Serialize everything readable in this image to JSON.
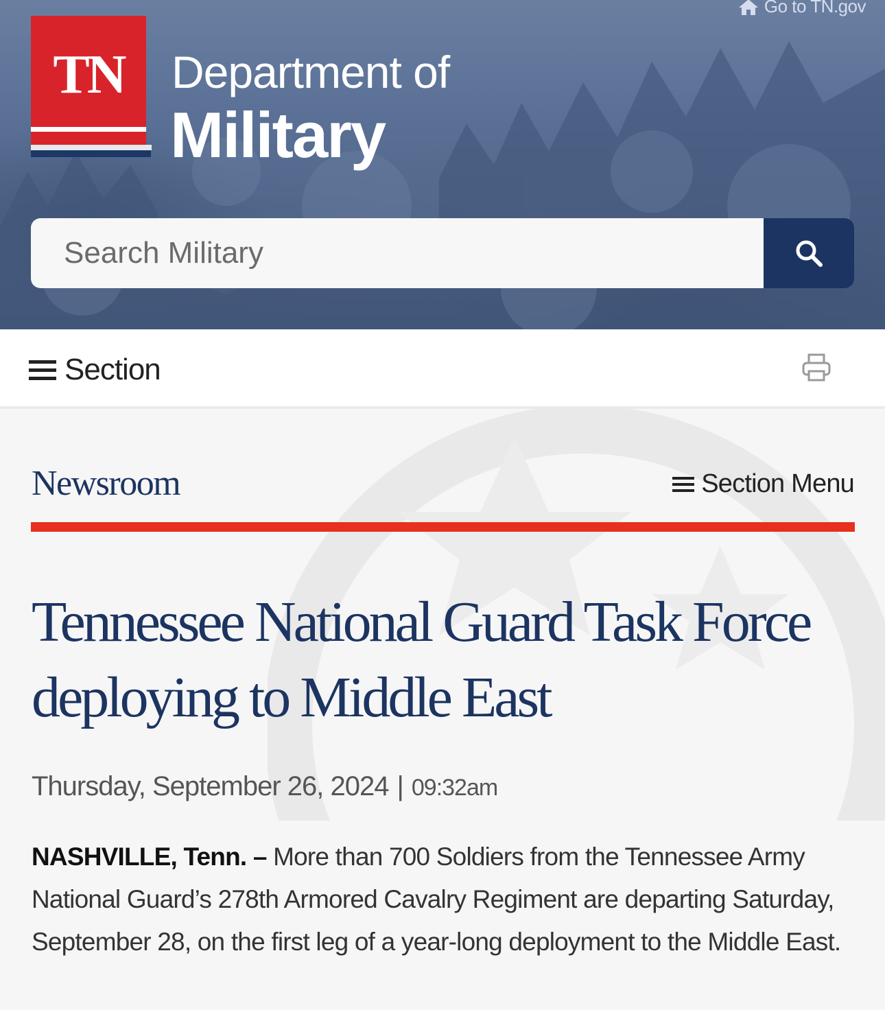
{
  "header": {
    "goto_link": "Go to TN.gov",
    "logo_text": "TN",
    "dept_of": "Department of",
    "dept_name": "Military",
    "search_placeholder": "Search Military",
    "search_icon": "search-icon"
  },
  "section_bar": {
    "toggle_label": "Section",
    "menu_icon": "hamburger-icon",
    "print_icon": "printer-icon"
  },
  "page": {
    "section_title": "Newsroom",
    "section_menu_label": "Section Menu"
  },
  "article": {
    "headline": "Tennessee National Guard Task Force deploying to Middle East",
    "date": "Thursday, September 26, 2024",
    "separator": "|",
    "time": "09:32am",
    "dateline_lead": "NASHVILLE, Tenn.",
    "dash": " – ",
    "body": "More than 700 Soldiers from the Tennessee Army National Guard’s 278th Armored Cavalry Regiment are departing Saturday, September 28, on the first leg of a year-long deployment to the Middle East."
  },
  "colors": {
    "brand_red": "#d8232a",
    "navy": "#1c3461",
    "rule_red": "#e7301f"
  }
}
